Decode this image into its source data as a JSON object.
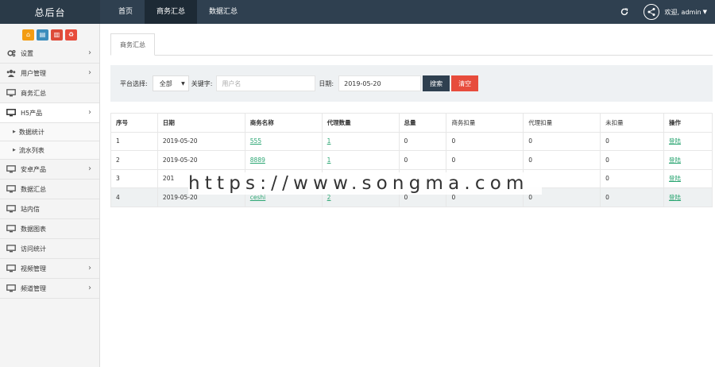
{
  "header": {
    "brand": "总后台",
    "nav": [
      "首页",
      "商务汇总",
      "数据汇总"
    ],
    "active_nav": 1,
    "user": "欢迎, admin"
  },
  "sidebar": {
    "quick_buttons": [
      {
        "icon": "home-icon",
        "color": "#f39c12"
      },
      {
        "icon": "file-icon",
        "color": "#3c8dbc"
      },
      {
        "icon": "trash-icon",
        "color": "#dd4b39"
      },
      {
        "icon": "recycle-icon",
        "color": "#e74c3c"
      }
    ],
    "items": [
      {
        "label": "设置",
        "icon": "gear-icon",
        "arrow": true
      },
      {
        "label": "用户管理",
        "icon": "users-icon",
        "arrow": true
      },
      {
        "label": "商务汇总",
        "icon": "monitor-icon",
        "arrow": false
      },
      {
        "label": "H5产品",
        "icon": "monitor-icon",
        "arrow": true,
        "open": true
      },
      {
        "label": "安卓产品",
        "icon": "monitor-icon",
        "arrow": true
      },
      {
        "label": "数据汇总",
        "icon": "monitor-icon",
        "arrow": false
      },
      {
        "label": "站内信",
        "icon": "monitor-icon",
        "arrow": false
      },
      {
        "label": "数据图表",
        "icon": "monitor-icon",
        "arrow": false
      },
      {
        "label": "访问统计",
        "icon": "monitor-icon",
        "arrow": false
      },
      {
        "label": "视频管理",
        "icon": "monitor-icon",
        "arrow": true
      },
      {
        "label": "频道管理",
        "icon": "monitor-icon",
        "arrow": true
      }
    ],
    "sub_items": [
      "数据统计",
      "流水列表"
    ]
  },
  "main": {
    "tab": "商务汇总",
    "search": {
      "platform_label": "平台选择:",
      "platform_value": "全部",
      "keyword_label": "关键字:",
      "keyword_placeholder": "用户名",
      "date_label": "日期:",
      "date_value": "2019-05-20",
      "search_btn": "搜索",
      "clear_btn": "清空"
    },
    "table": {
      "headers": [
        "序号",
        "日期",
        "商务名称",
        "代理数量",
        "总量",
        "商务扣量",
        "代理扣量",
        "未扣量",
        "操作"
      ],
      "rows": [
        [
          "1",
          "2019-05-20",
          "555",
          "1",
          "0",
          "0",
          "0",
          "0",
          "登陆"
        ],
        [
          "2",
          "2019-05-20",
          "8889",
          "1",
          "0",
          "0",
          "0",
          "0",
          "登陆"
        ],
        [
          "3",
          "201",
          "",
          "",
          "",
          "",
          "",
          "0",
          "登陆"
        ],
        [
          "4",
          "2019-05-20",
          "ceshi",
          "2",
          "0",
          "0",
          "0",
          "0",
          "登陆"
        ]
      ]
    }
  },
  "watermark": "https://www.songma.com",
  "colors": {
    "topbar": "#2f4050",
    "link": "#2ca673",
    "clear": "#e74c3c"
  }
}
